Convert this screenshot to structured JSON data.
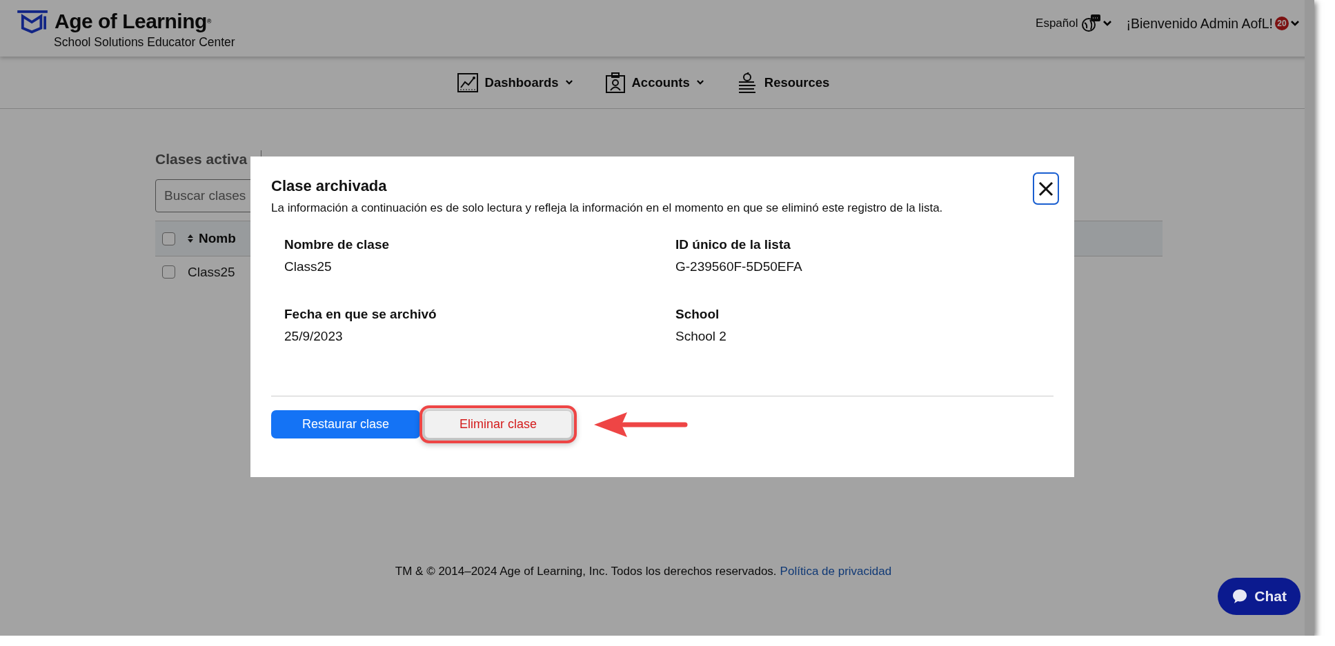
{
  "header": {
    "logo_title": "Age of Learning",
    "logo_mark": "®",
    "logo_subtitle": "School Solutions Educator Center",
    "language": "Español",
    "welcome": "¡Bienvenido Admin AofL!",
    "notification_count": "20"
  },
  "nav": [
    {
      "label": "Dashboards",
      "dropdown": true
    },
    {
      "label": "Accounts",
      "dropdown": true
    },
    {
      "label": "Resources",
      "dropdown": false
    }
  ],
  "tab_label": "Clases activa",
  "search": {
    "placeholder": "Buscar clases"
  },
  "table": {
    "header_checked": false,
    "columns": [
      {
        "label": "Nomb"
      }
    ],
    "rows": [
      {
        "checked": false,
        "cells": [
          "Class25"
        ]
      }
    ]
  },
  "modal": {
    "title": "Clase archivada",
    "description": "La información a continuación es de solo lectura y refleja la información en el momento en que se eliminó este registro de la lista.",
    "fields": [
      {
        "label": "Nombre de clase",
        "value": "Class25"
      },
      {
        "label": "ID único de la lista",
        "value": "G-239560F-5D50EFA"
      },
      {
        "label": "Fecha en que se archivó",
        "value": "25/9/2023"
      },
      {
        "label": "School",
        "value": "School 2"
      }
    ],
    "buttons": [
      {
        "label": "Restaurar clase",
        "kind": "primary",
        "highlighted": false
      },
      {
        "label": "Eliminar clase",
        "kind": "secondary",
        "highlighted": true
      }
    ]
  },
  "footer": {
    "copyright": "TM & © 2014–2024 Age of Learning, Inc. Todos los derechos reservados.",
    "link": "Política de privacidad"
  },
  "chat": {
    "label": "Chat"
  }
}
